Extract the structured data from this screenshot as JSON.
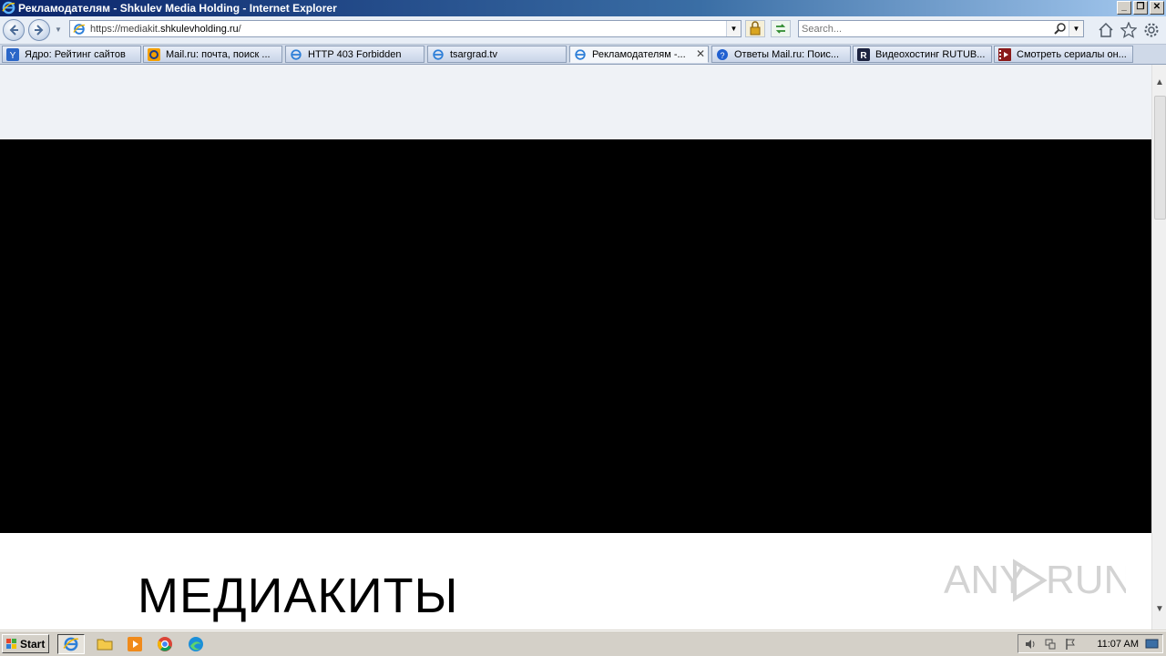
{
  "window": {
    "title": "Рекламодателям - Shkulev Media Holding - Internet Explorer",
    "buttons": [
      "_",
      "❐",
      "✕"
    ]
  },
  "navigation": {
    "url_prefix": "https://mediakit.",
    "url_domain": "shkulevholding.ru",
    "url_suffix": "/",
    "search_placeholder": "Search..."
  },
  "tabs": [
    {
      "label": "Ядро: Рейтинг сайтов",
      "icon": "yandex-icon",
      "active": false
    },
    {
      "label": "Mail.ru: почта, поиск ...",
      "icon": "mailru-icon",
      "active": false
    },
    {
      "label": "HTTP 403 Forbidden",
      "icon": "ie-page-icon",
      "active": false
    },
    {
      "label": "tsargrad.tv",
      "icon": "ie-page-icon",
      "active": false
    },
    {
      "label": "Рекламодателям -...",
      "icon": "ie-page-icon",
      "active": true
    },
    {
      "label": "Ответы Mail.ru: Поис...",
      "icon": "question-icon",
      "active": false
    },
    {
      "label": "Видеохостинг RUTUB...",
      "icon": "rutube-icon",
      "active": false
    },
    {
      "label": "Смотреть сериалы он...",
      "icon": "film-icon",
      "active": false
    }
  ],
  "page": {
    "heading": "МЕДИАКИТЫ",
    "watermark": "ANY RUN"
  },
  "taskbar": {
    "start_label": "Start",
    "clock": "11:07 AM"
  },
  "colors": {
    "header_bg": "#eff2f6",
    "hero_bg": "#000000",
    "titlebar": "#0a246a"
  }
}
